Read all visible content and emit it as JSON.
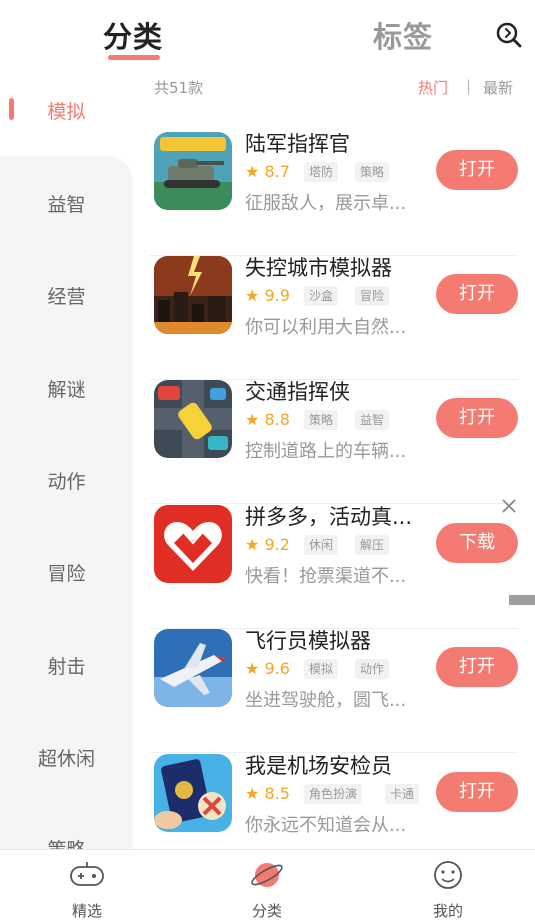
{
  "header": {
    "tab_category": "分类",
    "tab_tags": "标签",
    "search_icon": "search-icon"
  },
  "sidebar": {
    "items": [
      {
        "label": "模拟",
        "active": true
      },
      {
        "label": "益智"
      },
      {
        "label": "经营"
      },
      {
        "label": "解谜"
      },
      {
        "label": "动作"
      },
      {
        "label": "冒险"
      },
      {
        "label": "射击"
      },
      {
        "label": "超休闲"
      },
      {
        "label": "策略"
      }
    ]
  },
  "list_header": {
    "count": "共51款",
    "sort_hot": "热门",
    "sort_separator": "|",
    "sort_new": "最新"
  },
  "apps": [
    {
      "name": "陆军指挥官",
      "rating": "8.7",
      "tags": [
        "塔防",
        "策略"
      ],
      "desc": "征服敌人，展示卓...",
      "action": "打开"
    },
    {
      "name": "失控城市模拟器",
      "rating": "9.9",
      "tags": [
        "沙盒",
        "冒险"
      ],
      "desc": "你可以利用大自然...",
      "action": "打开"
    },
    {
      "name": "交通指挥侠",
      "rating": "8.8",
      "tags": [
        "策略",
        "益智"
      ],
      "desc": "控制道路上的车辆...",
      "action": "打开"
    },
    {
      "name": "拼多多，活动真...",
      "rating": "9.2",
      "tags": [
        "休闲",
        "解压"
      ],
      "desc": "快看！抢票渠道不...",
      "action": "下载"
    },
    {
      "name": "飞行员模拟器",
      "rating": "9.6",
      "tags": [
        "模拟",
        "动作"
      ],
      "desc": "坐进驾驶舱，圆飞...",
      "action": "打开"
    },
    {
      "name": "我是机场安检员",
      "rating": "8.5",
      "tags": [
        "角色扮演",
        "卡通"
      ],
      "desc": "你永远不知道会从...",
      "action": "打开"
    }
  ],
  "bottom_nav": [
    {
      "label": "精选",
      "icon": "gamepad-icon"
    },
    {
      "label": "分类",
      "icon": "planet-icon",
      "active": true
    },
    {
      "label": "我的",
      "icon": "smiley-icon"
    }
  ],
  "colors": {
    "accent": "#f47b71",
    "rating": "#f5a623"
  }
}
